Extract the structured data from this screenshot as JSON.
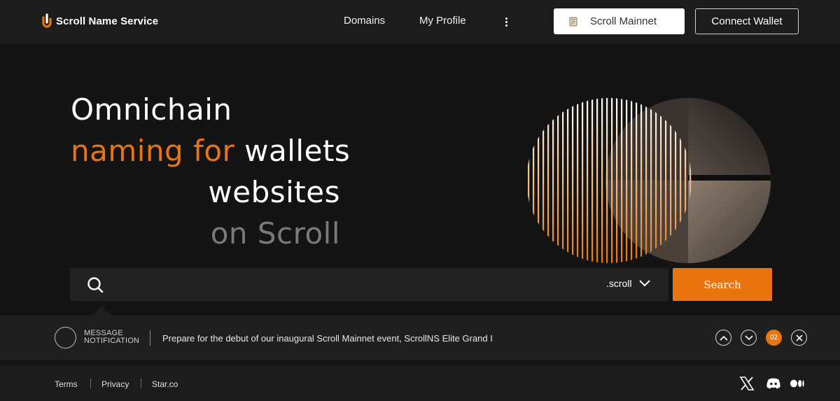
{
  "header": {
    "brand": "Scroll Name Service",
    "nav": {
      "domains": "Domains",
      "my_profile": "My Profile"
    },
    "network": "Scroll Mainnet",
    "connect": "Connect Wallet"
  },
  "hero": {
    "line1": "Omnichain",
    "line2_accent": "naming for",
    "line2_rest": " wallets",
    "line3": "websites",
    "line4": "on Scroll"
  },
  "search": {
    "placeholder": "",
    "value": "",
    "tld": ".scroll",
    "button": "Search"
  },
  "notification": {
    "tag_line1": "MESSAGE",
    "tag_line2": "NOTIFICATION",
    "message": "Prepare for the debut of our inaugural Scroll Mainnet event, ScrollNS Elite Grand I",
    "count": "02"
  },
  "footer": {
    "links": [
      "Terms",
      "Privacy",
      "Star.co"
    ]
  },
  "colors": {
    "accent": "#ea750f",
    "background": "#141414",
    "panel": "#1c1c1c"
  },
  "icons": {
    "brand": "scroll-logo-icon",
    "more": "kebab-menu-icon",
    "network": "scroll-parchment-icon",
    "search": "search-icon",
    "tld": "chevron-down-icon",
    "prev": "chevron-up-icon",
    "next": "chevron-down-icon",
    "close": "close-icon",
    "socials": [
      "x-icon",
      "discord-icon",
      "medium-icon"
    ]
  }
}
